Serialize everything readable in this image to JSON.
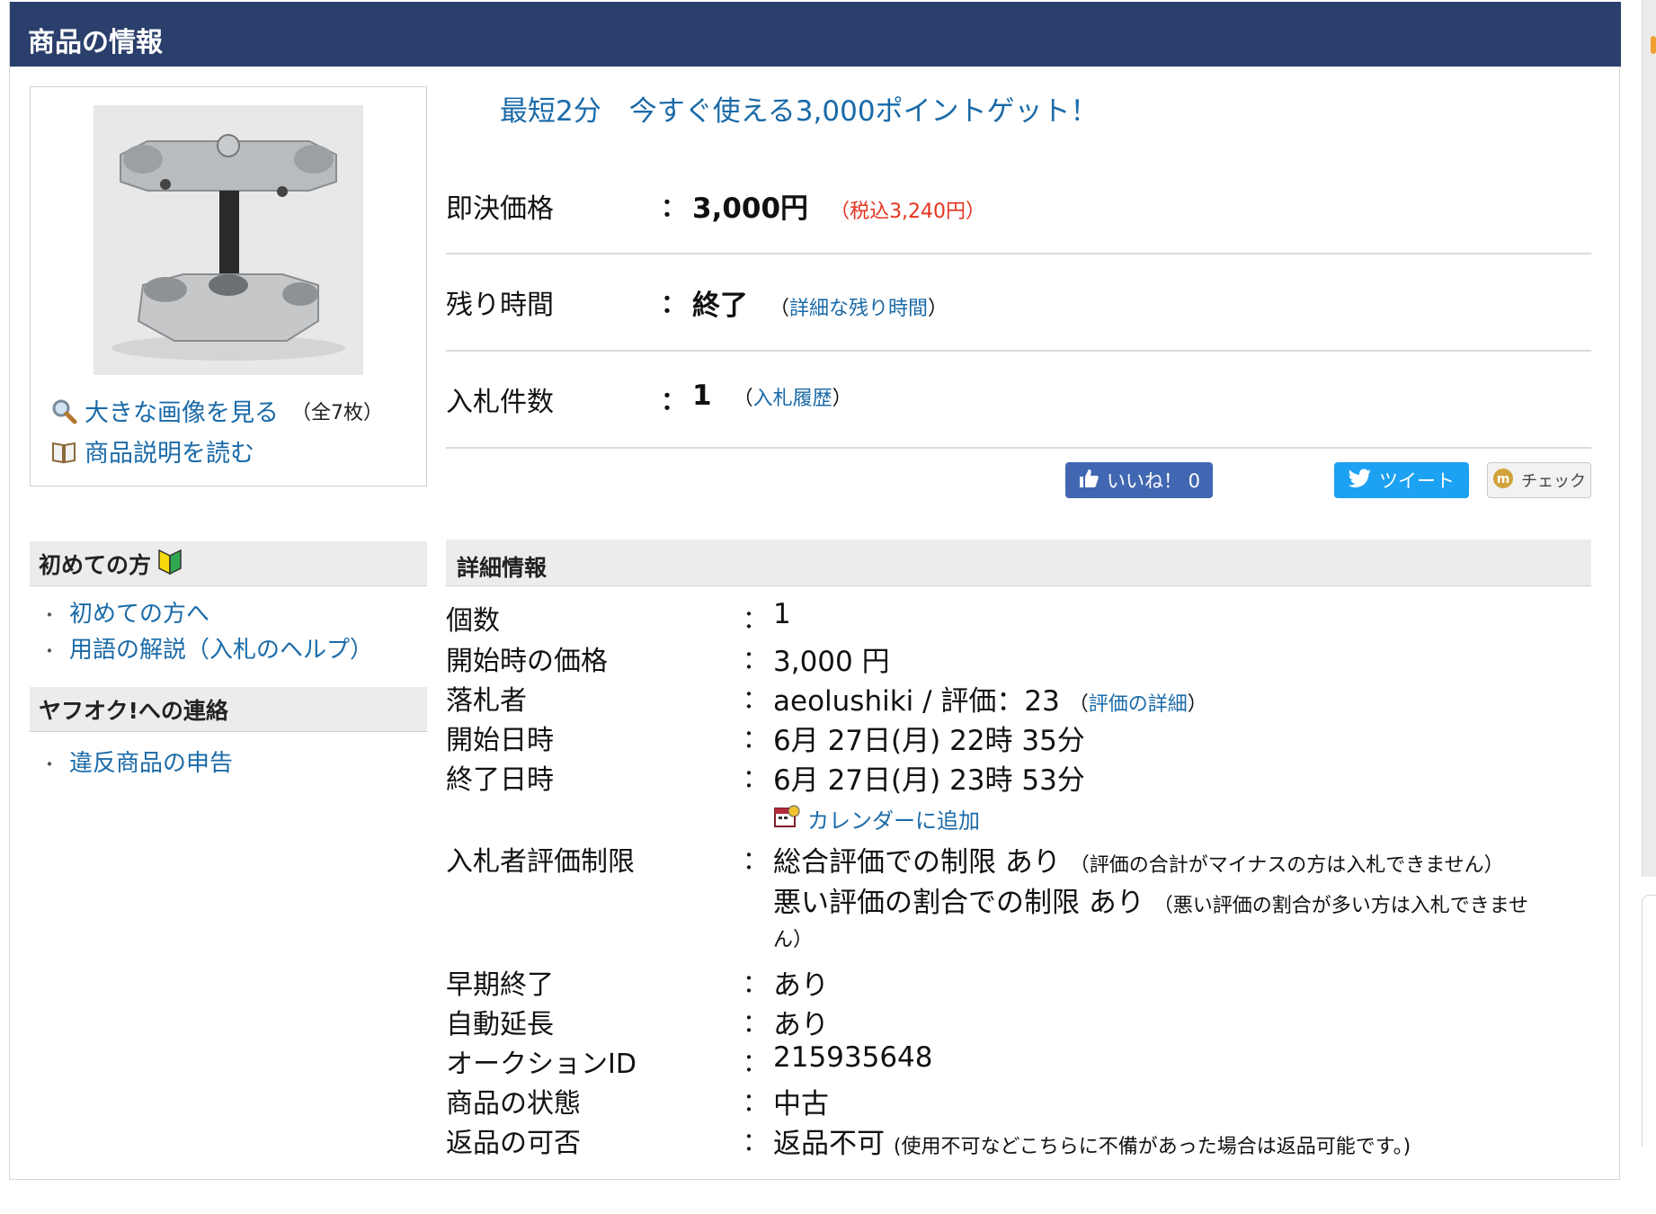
{
  "header": {
    "title": "商品の情報"
  },
  "image_box": {
    "view_large_label": "大きな画像を見る",
    "image_count": "（全7枚）",
    "read_description_label": "商品説明を読む"
  },
  "sidebar": {
    "beginners": {
      "title": "初めての方",
      "items": [
        "初めての方へ",
        "用語の解説（入札のヘルプ）"
      ]
    },
    "contact": {
      "title": "ヤフオク!への連絡",
      "items": [
        "違反商品の申告"
      ]
    }
  },
  "promo": "最短2分　今すぐ使える3,000ポイントゲット！",
  "summary": {
    "buy_now": {
      "label": "即決価格",
      "value": "3,000円",
      "tax": "（税込3,240円）"
    },
    "remaining": {
      "label": "残り時間",
      "value": "終了",
      "link": "詳細な残り時間",
      "paren_open": "（",
      "paren_close": "）"
    },
    "bids": {
      "label": "入札件数",
      "value": "1",
      "link": "入札履歴",
      "paren_open": "（",
      "paren_close": "）"
    },
    "colon": "："
  },
  "social": {
    "like_label": "いいね！ 0",
    "tweet_label": "ツイート",
    "check_label": "チェック"
  },
  "details": {
    "title": "詳細情報",
    "colon": "：",
    "rows": [
      {
        "label": "個数",
        "value": "1"
      },
      {
        "label": "開始時の価格",
        "value": "3,000 円"
      },
      {
        "label": "落札者",
        "value": "aeolushiki / 評価：23",
        "link": "評価の詳細"
      },
      {
        "label": "開始日時",
        "value": "6月 27日(月) 22時 35分"
      },
      {
        "label": "終了日時",
        "value": "6月 27日(月) 23時 53分"
      },
      {
        "label": "入札者評価制限",
        "value": "総合評価での制限 あり",
        "note": "（評価の合計がマイナスの方は入札できません）",
        "value2": "悪い評価の割合での制限 あり",
        "note2": "（悪い評価の割合が多い方は入札できませ",
        "note2b": "ん）"
      },
      {
        "label": "早期終了",
        "value": "あり"
      },
      {
        "label": "自動延長",
        "value": "あり"
      },
      {
        "label": "オークションID",
        "value": "215935648"
      },
      {
        "label": "商品の状態",
        "value": "中古"
      },
      {
        "label": "返品の可否",
        "value": "返品不可",
        "note": "(使用不可などこちらに不備があった場合は返品可能です。)"
      }
    ],
    "calendar_link": "カレンダーに追加"
  },
  "colors": {
    "header_bg": "#2b3f6c",
    "link": "#1a6aa8",
    "price_red": "#e6331f",
    "like_bg": "#4267b2",
    "tweet_bg": "#1da1f2"
  }
}
